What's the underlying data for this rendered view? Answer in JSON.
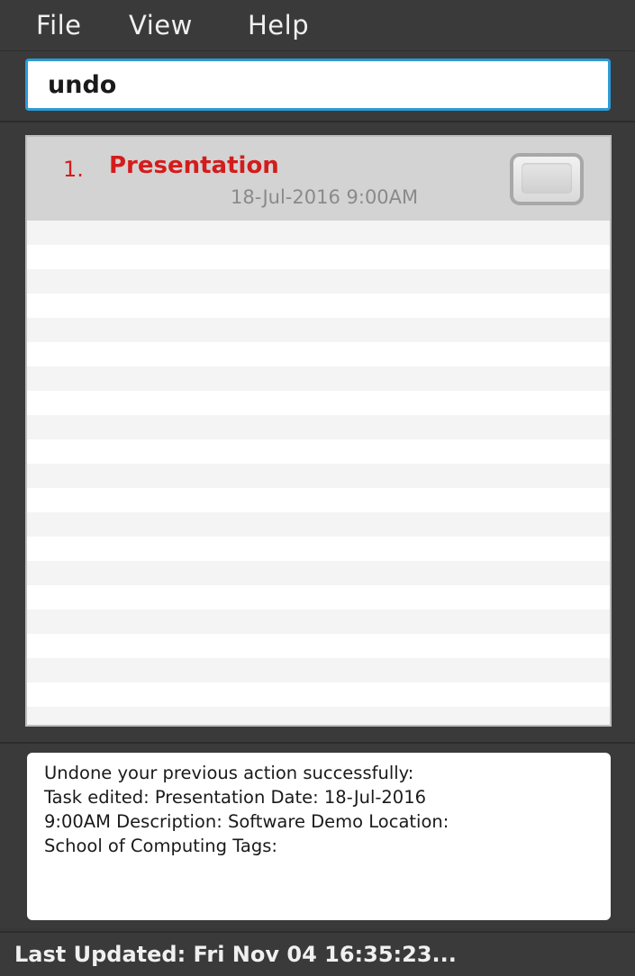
{
  "menu": {
    "file": "File",
    "view": "View",
    "help": "Help"
  },
  "command": {
    "value": "undo"
  },
  "tasks": [
    {
      "index": "1.",
      "name": "Presentation",
      "date": "18-Jul-2016 9:00AM",
      "done": false
    }
  ],
  "result": {
    "message": "Undone your previous action successfully:\nTask edited: Presentation Date: 18-Jul-2016\n9:00AM Description: Software Demo Location:\nSchool of Computing Tags:"
  },
  "status": {
    "last_updated": "Last Updated: Fri Nov 04 16:35:23..."
  },
  "colors": {
    "background": "#383838",
    "accent": "#2d9ad8",
    "task_name": "#d41c1c",
    "task_date": "#8a8a8a"
  }
}
